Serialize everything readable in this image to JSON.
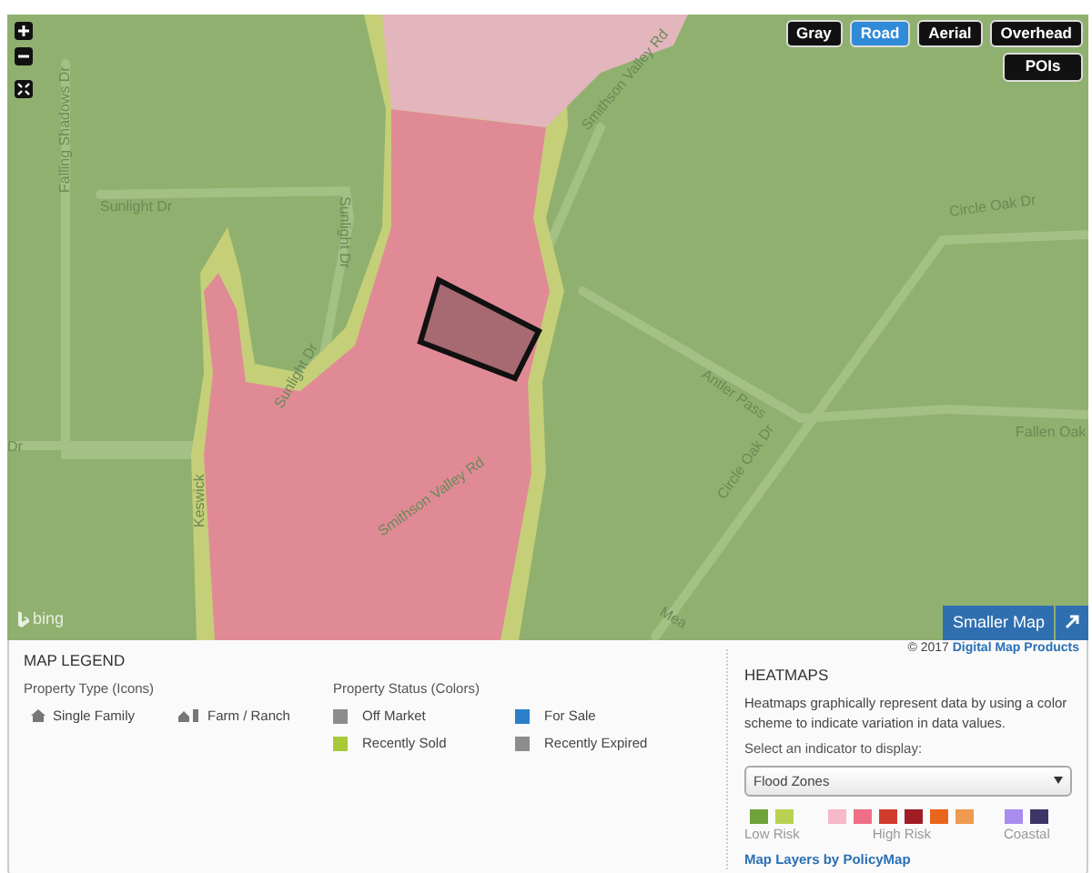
{
  "map": {
    "map_types": [
      {
        "label": "Gray",
        "selected": false
      },
      {
        "label": "Road",
        "selected": true
      },
      {
        "label": "Aerial",
        "selected": false
      },
      {
        "label": "Overhead",
        "selected": false
      }
    ],
    "pois_button": "POIs",
    "street_labels": [
      "Sunlight Dr",
      "Falling Shadows Dr",
      "Sunlight Dr",
      "Sunlight Dr",
      "Keswick",
      "Smithson Valley Rd",
      "Smithson Valley Rd",
      "Circle Oak Dr",
      "Antler Pass",
      "Circle Oak Dr",
      "Fallen Oak",
      "Mea",
      "Dr"
    ],
    "attribution": "bing",
    "smaller_map_button": "Smaller Map"
  },
  "legend": {
    "title": "MAP LEGEND",
    "property_type": {
      "heading": "Property Type (Icons)",
      "items": [
        {
          "label": "Single Family",
          "kind": "house"
        },
        {
          "label": "Farm / Ranch",
          "kind": "farm"
        }
      ]
    },
    "property_status": {
      "heading": "Property Status (Colors)",
      "items": [
        {
          "label": "Off Market",
          "color": "#8c8c8c"
        },
        {
          "label": "For Sale",
          "color": "#2a7fc8"
        },
        {
          "label": "Recently Sold",
          "color": "#a7c93a"
        },
        {
          "label": "Recently Expired",
          "color": "#8c8c8c"
        }
      ]
    },
    "copyright": "© 2017",
    "copyright_link": "Digital Map Products",
    "heatmaps": {
      "heading": "HEATMAPS",
      "description": "Heatmaps graphically represent data by using a color scheme to indicate variation in data values.",
      "select_label": "Select an indicator to display:",
      "select_value": "Flood Zones",
      "swatch_groups": [
        {
          "swatches": [
            {
              "color": "#6fa33a"
            },
            {
              "color": "#b9d150"
            }
          ],
          "label": "Low Risk"
        },
        {
          "swatches": [
            {
              "color": "#f6b9c8"
            },
            {
              "color": "#ef6f86"
            },
            {
              "color": "#d23c2c"
            },
            {
              "color": "#a11c25"
            },
            {
              "color": "#e7661b"
            },
            {
              "color": "#ee9a50"
            }
          ],
          "label": "High Risk"
        },
        {
          "swatches": [
            {
              "color": "#a88cf0"
            },
            {
              "color": "#3c3667"
            }
          ],
          "label": "Coastal"
        }
      ],
      "link": "Map Layers by PolicyMap"
    }
  }
}
